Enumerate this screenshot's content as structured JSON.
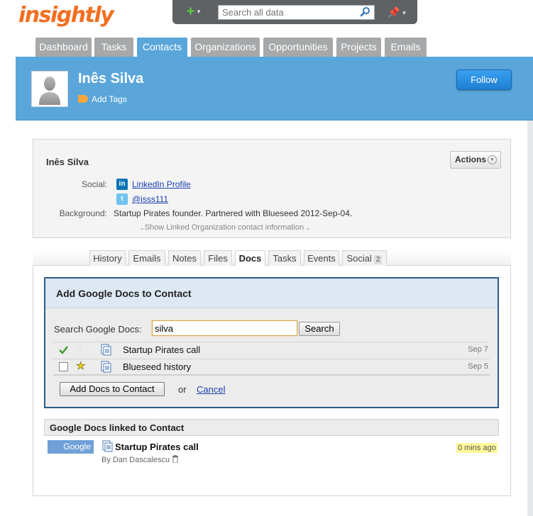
{
  "app": {
    "logo": "insightly"
  },
  "search": {
    "placeholder": "Search all data"
  },
  "nav": {
    "tabs": [
      "Dashboard",
      "Tasks",
      "Contacts",
      "Organizations",
      "Opportunities",
      "Projects",
      "Emails"
    ],
    "active": "Contacts"
  },
  "header": {
    "name": "Inês Silva",
    "add_tags": "Add Tags",
    "follow": "Follow"
  },
  "details": {
    "name": "Inês Silva",
    "actions": "Actions",
    "social_label": "Social:",
    "linkedin": "LinkedIn Profile",
    "twitter": "@isss111",
    "background_label": "Background:",
    "background": "Startup Pirates founder. Partnered with Blueseed 2012-Sep-04.",
    "show_linked": "Show Linked Organization contact information"
  },
  "doc_tabs": {
    "items": [
      "History",
      "Emails",
      "Notes",
      "Files",
      "Docs",
      "Tasks",
      "Events",
      "Social"
    ],
    "active": "Docs",
    "social_count": "2"
  },
  "gdocs": {
    "title": "Add Google Docs to Contact",
    "search_label": "Search Google Docs:",
    "search_value": "silva",
    "search_button": "Search",
    "results": [
      {
        "name": "Startup Pirates call",
        "date": "Sep 7",
        "checked": true,
        "starred": false
      },
      {
        "name": "Blueseed history",
        "date": "Sep 5",
        "checked": false,
        "starred": true
      }
    ],
    "add_button": "Add Docs to Contact",
    "or": "or",
    "cancel": "Cancel"
  },
  "linked": {
    "title": "Google Docs linked to Contact",
    "source": "Google",
    "doc_name": "Startup Pirates call",
    "by": "By Dan Dascalescu",
    "ago": "0 mins ago"
  },
  "colors": {
    "brand": "#f26f21",
    "header_blue": "#5aa6da",
    "follow_button": "#1f7fd3",
    "panel_border": "#2c5a8c"
  }
}
